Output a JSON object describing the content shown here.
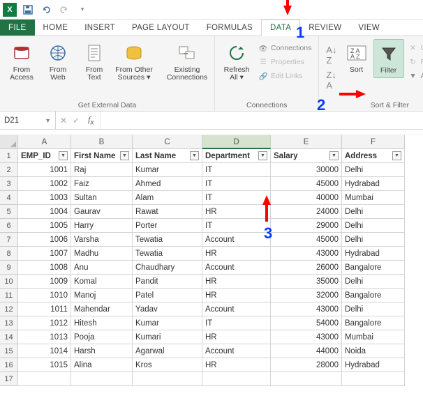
{
  "qat": {
    "logo": "X"
  },
  "tabs": [
    "FILE",
    "HOME",
    "INSERT",
    "PAGE LAYOUT",
    "FORMULAS",
    "DATA",
    "REVIEW",
    "VIEW"
  ],
  "active_tab": "DATA",
  "ribbon": {
    "get_data": {
      "from_access": "From\nAccess",
      "from_web": "From\nWeb",
      "from_text": "From\nText",
      "from_other": "From Other\nSources ▾",
      "existing": "Existing\nConnections",
      "title": "Get External Data"
    },
    "connections": {
      "refresh": "Refresh\nAll ▾",
      "connections": "Connections",
      "properties": "Properties",
      "edit_links": "Edit Links",
      "title": "Connections"
    },
    "sort_filter": {
      "sort": "Sort",
      "filter": "Filter",
      "clear": "Clear",
      "reapply": "Reapply",
      "advanced": "Advanced",
      "title": "Sort & Filter"
    }
  },
  "name_box": "D21",
  "formula": "",
  "columns": [
    "A",
    "B",
    "C",
    "D",
    "E",
    "F"
  ],
  "selected_col": "D",
  "headers": [
    "EMP_ID",
    "First Name",
    "Last Name",
    "Department",
    "Salary",
    "Address"
  ],
  "rows": [
    {
      "id": 1001,
      "first": "Raj",
      "last": "Kumar",
      "dept": "IT",
      "salary": 30000,
      "addr": "Delhi"
    },
    {
      "id": 1002,
      "first": "Faiz",
      "last": "Ahmed",
      "dept": "IT",
      "salary": 45000,
      "addr": "Hydrabad"
    },
    {
      "id": 1003,
      "first": "Sultan",
      "last": "Alam",
      "dept": "IT",
      "salary": 40000,
      "addr": "Mumbai"
    },
    {
      "id": 1004,
      "first": "Gaurav",
      "last": "Rawat",
      "dept": "HR",
      "salary": 24000,
      "addr": "Delhi"
    },
    {
      "id": 1005,
      "first": "Harry",
      "last": "Porter",
      "dept": "IT",
      "salary": 29000,
      "addr": "Delhi"
    },
    {
      "id": 1006,
      "first": "Varsha",
      "last": "Tewatia",
      "dept": "Account",
      "salary": 45000,
      "addr": "Delhi"
    },
    {
      "id": 1007,
      "first": "Madhu",
      "last": "Tewatia",
      "dept": "HR",
      "salary": 43000,
      "addr": "Hydrabad"
    },
    {
      "id": 1008,
      "first": "Anu",
      "last": "Chaudhary",
      "dept": "Account",
      "salary": 26000,
      "addr": "Bangalore"
    },
    {
      "id": 1009,
      "first": "Komal",
      "last": "Pandit",
      "dept": "HR",
      "salary": 35000,
      "addr": "Delhi"
    },
    {
      "id": 1010,
      "first": "Manoj",
      "last": "Patel",
      "dept": "HR",
      "salary": 32000,
      "addr": "Bangalore"
    },
    {
      "id": 1011,
      "first": "Mahendar",
      "last": "Yadav",
      "dept": "Account",
      "salary": 43000,
      "addr": "Delhi"
    },
    {
      "id": 1012,
      "first": "Hitesh",
      "last": "Kumar",
      "dept": "IT",
      "salary": 54000,
      "addr": "Bangalore"
    },
    {
      "id": 1013,
      "first": "Pooja",
      "last": "Kumari",
      "dept": "HR",
      "salary": 43000,
      "addr": "Mumbai"
    },
    {
      "id": 1014,
      "first": "Harsh",
      "last": "Agarwal",
      "dept": "Account",
      "salary": 44000,
      "addr": "Noida"
    },
    {
      "id": 1015,
      "first": "Alina",
      "last": "Kros",
      "dept": "HR",
      "salary": 28000,
      "addr": "Hydrabad"
    }
  ],
  "annotations": {
    "n1": "1",
    "n2": "2",
    "n3": "3"
  }
}
